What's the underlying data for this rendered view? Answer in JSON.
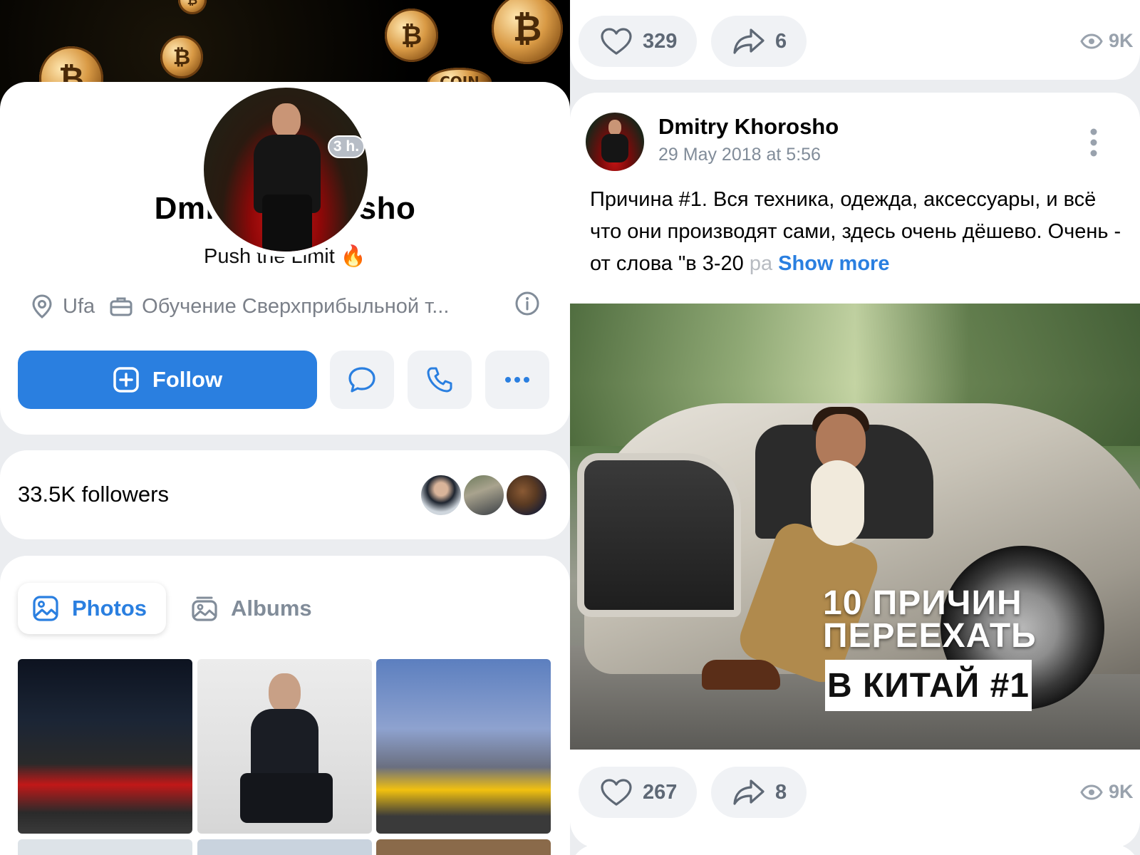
{
  "profile": {
    "name": "Dmitry Khorosho",
    "status": "Push the Limit",
    "status_emoji": "🔥",
    "time_badge": "3 h.",
    "city": "Ufa",
    "work": "Обучение Сверхприбыльной т...",
    "follow_label": "Follow",
    "icons": [
      "location-pin-icon",
      "briefcase-icon",
      "info-icon",
      "message-icon",
      "phone-icon",
      "more-icon"
    ]
  },
  "followers": {
    "label": "33.5K followers"
  },
  "media_tabs": {
    "photos": "Photos",
    "albums": "Albums"
  },
  "top_post_stats": {
    "likes": "329",
    "shares": "6",
    "views": "9K"
  },
  "post": {
    "author": "Dmitry Khorosho",
    "date": "29 May 2018 at 5:56",
    "text": "Причина #1. Вся техника, одежда, аксессуары, и всё что они производят сами, здесь очень дёшево. Очень - от слова \"в 3-20 ",
    "text_fade": "ра",
    "show_more": "Show more",
    "image_title_line1": "10 ПРИЧИН",
    "image_title_line2": "ПЕРЕЕХАТЬ",
    "image_title_box": "В КИТАЙ #1",
    "likes": "267",
    "shares": "8",
    "views": "9K"
  },
  "colors": {
    "accent": "#2a7fe0",
    "background": "#ebedf0",
    "secondary_text": "#818c99"
  }
}
